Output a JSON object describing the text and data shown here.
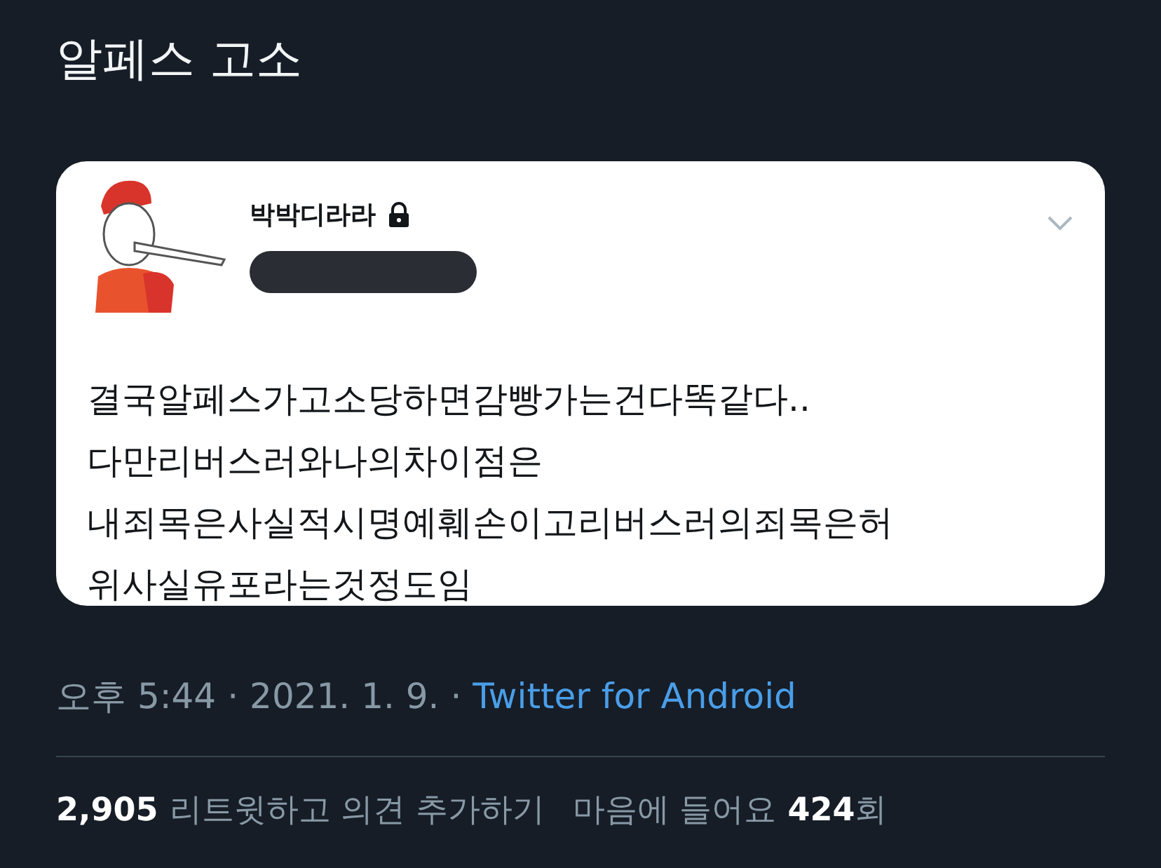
{
  "header": {
    "title": "알페스 고소"
  },
  "embedded_post": {
    "author_name": "박박디라라",
    "locked": true,
    "text_lines": [
      "결국알페스가고소당하면감빵가는건다똑같다..",
      "다만리버스러와나의차이점은",
      "내죄목은사실적시명예훼손이고리버스러의죄목은허",
      "위사실유포라는것정도임"
    ]
  },
  "meta": {
    "time": "오후 5:44",
    "separator_1": "·",
    "date": "2021. 1. 9.",
    "separator_2": "·",
    "source": "Twitter for Android"
  },
  "stats": {
    "retweet_count": "2,905",
    "retweet_label": "리트윗하고 의견 추가하기",
    "like_label": "마음에 들어요",
    "like_count": "424",
    "like_suffix": "회"
  }
}
